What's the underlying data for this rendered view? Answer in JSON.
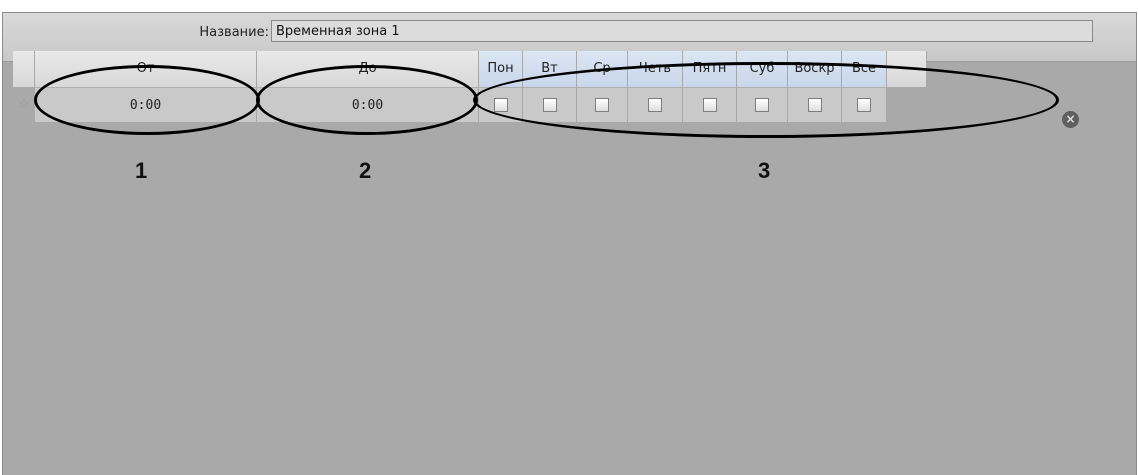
{
  "name_field": {
    "label": "Название:",
    "value": "Временная зона 1"
  },
  "columns": {
    "from": "От",
    "to": "До",
    "days": [
      "Пон",
      "Вт",
      "Ср",
      "Четв",
      "Пятн",
      "Суб",
      "Воскр",
      "Все"
    ]
  },
  "row": {
    "from_value": "0:00",
    "to_value": "0:00",
    "day_checked": [
      false,
      false,
      false,
      false,
      false,
      false,
      false,
      false
    ]
  },
  "icons": {
    "row_marker": "star-icon",
    "delete": "delete-row-icon"
  },
  "annotations": [
    "1",
    "2",
    "3"
  ]
}
